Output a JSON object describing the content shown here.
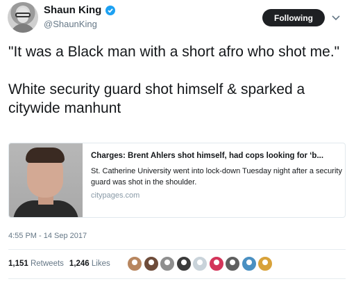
{
  "author": {
    "name": "Shaun King",
    "handle": "@ShaunKing",
    "verified": true
  },
  "follow_button": {
    "label": "Following"
  },
  "tweet": {
    "line1": "\"It was a Black man with a short afro who shot me.\"",
    "line2": "White security guard shot himself & sparked a citywide manhunt"
  },
  "card": {
    "title": "Charges: Brent Ahlers shot himself, had cops looking for ‘b...",
    "description": "St. Catherine University went into lock-down Tuesday night after a security guard was shot in the shoulder.",
    "domain": "citypages.com"
  },
  "timestamp": "4:55 PM - 14 Sep 2017",
  "stats": {
    "retweets_count": "1,151",
    "retweets_label": "Retweets",
    "likes_count": "1,246",
    "likes_label": "Likes"
  },
  "colors": {
    "verified": "#1da1f2",
    "button_bg": "#1e2023",
    "muted": "#657786"
  },
  "liker_avatars": [
    {
      "color": "#b8865f"
    },
    {
      "color": "#6e4c3a"
    },
    {
      "color": "#8f8f8f"
    },
    {
      "color": "#3b3b3b"
    },
    {
      "color": "#c9d3da"
    },
    {
      "color": "#d3355a"
    },
    {
      "color": "#5f5f5f"
    },
    {
      "color": "#4a90c2"
    },
    {
      "color": "#d8a23a"
    }
  ]
}
